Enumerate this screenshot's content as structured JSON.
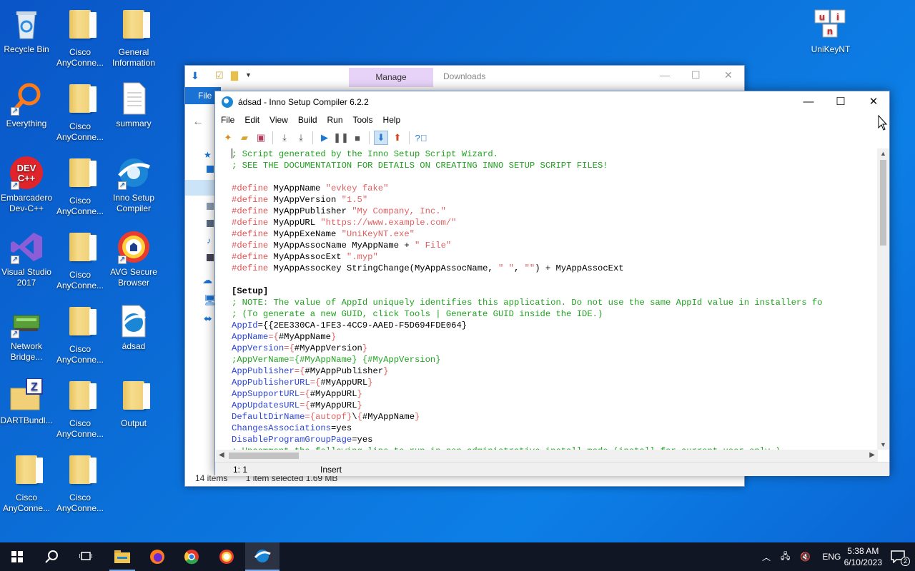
{
  "desktop": {
    "icons": [
      {
        "label": "Recycle Bin"
      },
      {
        "label": "Cisco AnyConne..."
      },
      {
        "label": "General Information"
      },
      {
        "label": "Everything"
      },
      {
        "label": "Cisco AnyConne..."
      },
      {
        "label": "summary"
      },
      {
        "label": "Embarcadero Dev-C++"
      },
      {
        "label": "Cisco AnyConne..."
      },
      {
        "label": "Inno Setup Compiler"
      },
      {
        "label": "Visual Studio 2017"
      },
      {
        "label": "Cisco AnyConne..."
      },
      {
        "label": "AVG Secure Browser"
      },
      {
        "label": "Network Bridge..."
      },
      {
        "label": "Cisco AnyConne..."
      },
      {
        "label": "ádsad"
      },
      {
        "label": "DARTBundl..."
      },
      {
        "label": "Cisco AnyConne..."
      },
      {
        "label": "Output"
      },
      {
        "label": "Cisco AnyConne..."
      },
      {
        "label": "Cisco AnyConne..."
      },
      {
        "label": "UniKeyNT"
      }
    ]
  },
  "explorer": {
    "manage_tab": "Manage",
    "downloads_tab": "Downloads",
    "file_tab": "File",
    "status_items": "14 items",
    "status_selected": "1 item selected  1.69 MB"
  },
  "inno": {
    "title": "ádsad - Inno Setup Compiler 6.2.2",
    "menu": [
      "File",
      "Edit",
      "View",
      "Build",
      "Run",
      "Tools",
      "Help"
    ],
    "lines": [
      [
        {
          "t": "; Script generated by the Inno Setup Script Wizard.",
          "c": "comment"
        }
      ],
      [
        {
          "t": "; SEE THE DOCUMENTATION FOR DETAILS ON CREATING INNO SETUP SCRIPT FILES!",
          "c": "comment"
        }
      ],
      [],
      [
        {
          "t": "#define",
          "c": "pre"
        },
        {
          "t": " MyAppName ",
          "c": "plain"
        },
        {
          "t": "\"evkey fake\"",
          "c": "str"
        }
      ],
      [
        {
          "t": "#define",
          "c": "pre"
        },
        {
          "t": " MyAppVersion ",
          "c": "plain"
        },
        {
          "t": "\"1.5\"",
          "c": "str"
        }
      ],
      [
        {
          "t": "#define",
          "c": "pre"
        },
        {
          "t": " MyAppPublisher ",
          "c": "plain"
        },
        {
          "t": "\"My Company, Inc.\"",
          "c": "str"
        }
      ],
      [
        {
          "t": "#define",
          "c": "pre"
        },
        {
          "t": " MyAppURL ",
          "c": "plain"
        },
        {
          "t": "\"https://www.example.com/\"",
          "c": "str"
        }
      ],
      [
        {
          "t": "#define",
          "c": "pre"
        },
        {
          "t": " MyAppExeName ",
          "c": "plain"
        },
        {
          "t": "\"UniKeyNT.exe\"",
          "c": "str"
        }
      ],
      [
        {
          "t": "#define",
          "c": "pre"
        },
        {
          "t": " MyAppAssocName MyAppName + ",
          "c": "plain"
        },
        {
          "t": "\" File\"",
          "c": "str"
        }
      ],
      [
        {
          "t": "#define",
          "c": "pre"
        },
        {
          "t": " MyAppAssocExt ",
          "c": "plain"
        },
        {
          "t": "\".myp\"",
          "c": "str"
        }
      ],
      [
        {
          "t": "#define",
          "c": "pre"
        },
        {
          "t": " MyAppAssocKey StringChange(MyAppAssocName, ",
          "c": "plain"
        },
        {
          "t": "\" \"",
          "c": "str"
        },
        {
          "t": ", ",
          "c": "plain"
        },
        {
          "t": "\"\"",
          "c": "str"
        },
        {
          "t": ") + MyAppAssocExt",
          "c": "plain"
        }
      ],
      [],
      [
        {
          "t": "[Setup]",
          "c": "sect"
        }
      ],
      [
        {
          "t": "; NOTE: The value of AppId uniquely identifies this application. Do not use the same AppId value in installers fo",
          "c": "comment"
        }
      ],
      [
        {
          "t": "; (To generate a new GUID, click Tools | Generate GUID inside the IDE.)",
          "c": "comment"
        }
      ],
      [
        {
          "t": "AppId",
          "c": "key"
        },
        {
          "t": "={{2EE330CA-1FE3-4CC9-AAED-F5D694FDE064}",
          "c": "plain"
        }
      ],
      [
        {
          "t": "AppName",
          "c": "key"
        },
        {
          "t": "={",
          "c": "const"
        },
        {
          "t": "#MyAppName",
          "c": "plain"
        },
        {
          "t": "}",
          "c": "const"
        }
      ],
      [
        {
          "t": "AppVersion",
          "c": "key"
        },
        {
          "t": "={",
          "c": "const"
        },
        {
          "t": "#MyAppVersion",
          "c": "plain"
        },
        {
          "t": "}",
          "c": "const"
        }
      ],
      [
        {
          "t": ";AppVerName={#MyAppName} {#MyAppVersion}",
          "c": "comment"
        }
      ],
      [
        {
          "t": "AppPublisher",
          "c": "key"
        },
        {
          "t": "={",
          "c": "const"
        },
        {
          "t": "#MyAppPublisher",
          "c": "plain"
        },
        {
          "t": "}",
          "c": "const"
        }
      ],
      [
        {
          "t": "AppPublisherURL",
          "c": "key"
        },
        {
          "t": "={",
          "c": "const"
        },
        {
          "t": "#MyAppURL",
          "c": "plain"
        },
        {
          "t": "}",
          "c": "const"
        }
      ],
      [
        {
          "t": "AppSupportURL",
          "c": "key"
        },
        {
          "t": "={",
          "c": "const"
        },
        {
          "t": "#MyAppURL",
          "c": "plain"
        },
        {
          "t": "}",
          "c": "const"
        }
      ],
      [
        {
          "t": "AppUpdatesURL",
          "c": "key"
        },
        {
          "t": "={",
          "c": "const"
        },
        {
          "t": "#MyAppURL",
          "c": "plain"
        },
        {
          "t": "}",
          "c": "const"
        }
      ],
      [
        {
          "t": "DefaultDirName",
          "c": "key"
        },
        {
          "t": "={autopf}",
          "c": "const"
        },
        {
          "t": "\\",
          "c": "plain"
        },
        {
          "t": "{",
          "c": "const"
        },
        {
          "t": "#MyAppName",
          "c": "plain"
        },
        {
          "t": "}",
          "c": "const"
        }
      ],
      [
        {
          "t": "ChangesAssociations",
          "c": "key"
        },
        {
          "t": "=yes",
          "c": "plain"
        }
      ],
      [
        {
          "t": "DisableProgramGroupPage",
          "c": "key"
        },
        {
          "t": "=yes",
          "c": "plain"
        }
      ],
      [
        {
          "t": "; Uncomment the following line to run in non administrative install mode (install for current user only.)",
          "c": "comment"
        }
      ]
    ],
    "status_pos": "1:   1",
    "status_mode": "Insert"
  },
  "taskbar": {
    "lang": "ENG",
    "time": "5:38 AM",
    "date": "6/10/2023",
    "notif_count": "2"
  }
}
